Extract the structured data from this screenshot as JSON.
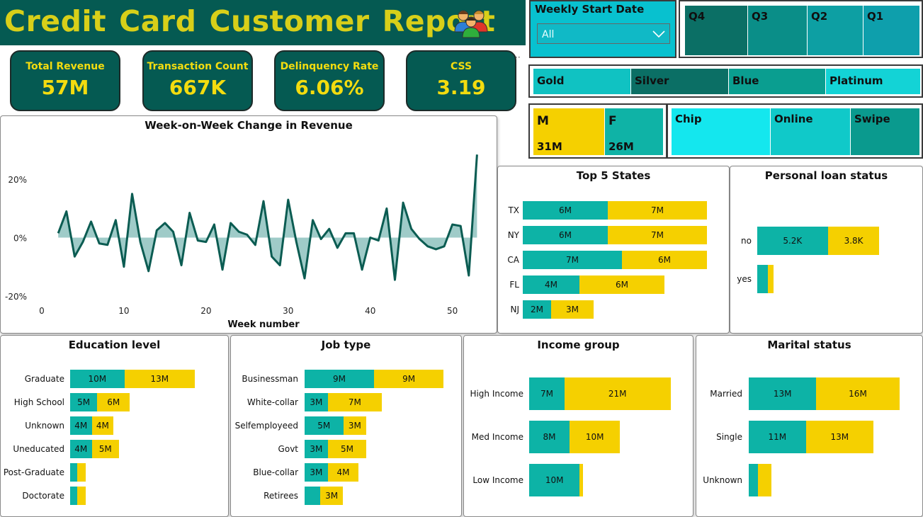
{
  "header": {
    "title_words": [
      "Credit",
      "Card",
      "Customer",
      "Report"
    ],
    "icon": "people-group-icon"
  },
  "kpis": [
    {
      "label": "Total Revenue",
      "value": "57M"
    },
    {
      "label": "Transaction Count",
      "value": "667K"
    },
    {
      "label": "Delinquency Rate",
      "value": "6.06%"
    },
    {
      "label": "CSS",
      "value": "3.19"
    }
  ],
  "slicers": {
    "weekly_start_date": {
      "label": "Weekly Start Date",
      "selected": "All"
    },
    "quarters": [
      "Q4",
      "Q3",
      "Q2",
      "Q1"
    ],
    "card_category": [
      "Gold",
      "Silver",
      "Blue",
      "Platinum"
    ],
    "gender": [
      {
        "label": "M",
        "value": "31M"
      },
      {
        "label": "F",
        "value": "26M"
      }
    ],
    "use_chip": [
      "Chip",
      "Online",
      "Swipe"
    ]
  },
  "colors": {
    "header_bg": "#055a52",
    "title_yellow": "#d8cf19",
    "kpi_yellow": "#f3dc0f",
    "series_teal": "#0db3a6",
    "series_yellow": "#f5d000",
    "line_dark": "#0b5c52",
    "area_fill": "#7fb9b5"
  },
  "chart_data": [
    {
      "id": "wow",
      "type": "area",
      "title": "Week-on-Week Change in Revenue",
      "xlabel": "Week number",
      "ylabel": "",
      "x_ticks": [
        0,
        10,
        20,
        30,
        40,
        50
      ],
      "y_tick_labels": [
        "20%",
        "0%",
        "-20%"
      ],
      "y_ticks": [
        20,
        0,
        -20
      ],
      "xlim": [
        0,
        54
      ],
      "ylim": [
        -22,
        22
      ],
      "x": [
        2,
        3,
        4,
        5,
        6,
        7,
        8,
        9,
        10,
        11,
        12,
        13,
        14,
        15,
        16,
        17,
        18,
        19,
        20,
        21,
        22,
        23,
        24,
        25,
        26,
        27,
        28,
        29,
        30,
        31,
        32,
        33,
        34,
        35,
        36,
        37,
        38,
        39,
        40,
        41,
        42,
        43,
        44,
        45,
        46,
        47,
        48,
        49,
        50,
        51,
        52,
        53
      ],
      "values": [
        1.5,
        9,
        -6.5,
        -1.5,
        5.5,
        -2,
        -2.5,
        6,
        -10,
        15,
        -1.5,
        -11.5,
        2.5,
        5,
        2,
        -9.5,
        8.5,
        -1,
        -1.5,
        4.5,
        -11,
        5,
        2,
        1,
        -2.5,
        12.5,
        -6.5,
        -9.5,
        13,
        -1.5,
        -14,
        6,
        -0.5,
        3,
        -3.5,
        1.5,
        1.5,
        -11,
        0,
        -1,
        10,
        -14.5,
        12,
        3,
        -0.5,
        -3,
        -4,
        -3,
        4.5,
        4,
        -13,
        28.5
      ]
    },
    {
      "id": "states",
      "type": "bar",
      "title": "Top 5 States",
      "categories": [
        "TX",
        "NY",
        "CA",
        "FL",
        "NJ"
      ],
      "series": [
        {
          "values": [
            6,
            6,
            7,
            4,
            2
          ],
          "labels": [
            "6M",
            "6M",
            "7M",
            "4M",
            "2M"
          ]
        },
        {
          "values": [
            7,
            7,
            6,
            6,
            3
          ],
          "labels": [
            "7M",
            "7M",
            "6M",
            "6M",
            "3M"
          ]
        }
      ],
      "xlim": [
        0,
        14
      ]
    },
    {
      "id": "loan",
      "type": "bar",
      "title": "Personal loan status",
      "categories": [
        "no",
        "yes"
      ],
      "series": [
        {
          "values": [
            5.2,
            0.8
          ],
          "labels": [
            "5.2K",
            ""
          ]
        },
        {
          "values": [
            3.8,
            0.4
          ],
          "labels": [
            "3.8K",
            ""
          ]
        }
      ],
      "xlim": [
        0,
        12
      ]
    },
    {
      "id": "education",
      "type": "bar",
      "title": "Education level",
      "categories": [
        "Graduate",
        "High School",
        "Unknown",
        "Uneducated",
        "Post-Graduate",
        "Doctorate"
      ],
      "series": [
        {
          "values": [
            10,
            5,
            4,
            4,
            1.3,
            1.3
          ],
          "labels": [
            "10M",
            "5M",
            "4M",
            "4M",
            "",
            ""
          ]
        },
        {
          "values": [
            13,
            6,
            4,
            5,
            1.6,
            1.6
          ],
          "labels": [
            "13M",
            "6M",
            "4M",
            "5M",
            "",
            ""
          ]
        }
      ],
      "xlim": [
        0,
        29
      ]
    },
    {
      "id": "job",
      "type": "bar",
      "title": "Job type",
      "categories": [
        "Businessman",
        "White-collar",
        "Selfemployeed",
        "Govt",
        "Blue-collar",
        "Retirees"
      ],
      "series": [
        {
          "values": [
            9,
            3,
            5,
            3,
            3,
            2
          ],
          "labels": [
            "9M",
            "3M",
            "5M",
            "3M",
            "3M",
            ""
          ]
        },
        {
          "values": [
            9,
            7,
            3,
            5,
            4,
            3
          ],
          "labels": [
            "9M",
            "7M",
            "3M",
            "5M",
            "4M",
            "3M"
          ]
        }
      ],
      "xlim": [
        0,
        20
      ]
    },
    {
      "id": "income",
      "type": "bar",
      "title": "Income group",
      "categories": [
        "High Income",
        "Med Income",
        "Low Income"
      ],
      "series": [
        {
          "values": [
            7,
            8,
            10
          ],
          "labels": [
            "7M",
            "8M",
            "10M"
          ]
        },
        {
          "values": [
            21,
            10,
            0.6
          ],
          "labels": [
            "21M",
            "10M",
            ""
          ]
        }
      ],
      "xlim": [
        0,
        32
      ]
    },
    {
      "id": "marital",
      "type": "bar",
      "title": "Marital status",
      "categories": [
        "Married",
        "Single",
        "Unknown"
      ],
      "series": [
        {
          "values": [
            13,
            11,
            1.8
          ],
          "labels": [
            "13M",
            "11M",
            ""
          ]
        },
        {
          "values": [
            16,
            13,
            2.5
          ],
          "labels": [
            "16M",
            "13M",
            ""
          ]
        }
      ],
      "xlim": [
        0,
        33
      ]
    }
  ]
}
